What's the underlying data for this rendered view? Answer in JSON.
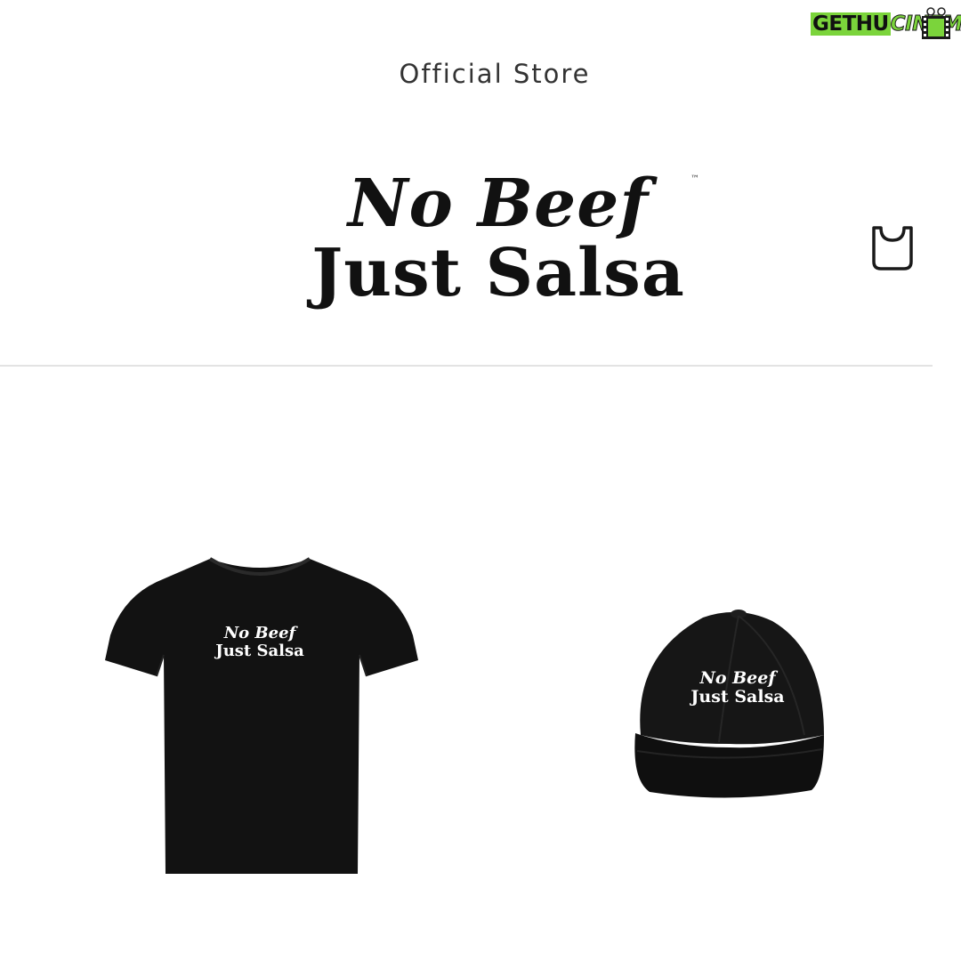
{
  "watermark": {
    "part1": "GETHU",
    "part2": "CINEMA"
  },
  "header": {
    "store_label": "Official Store",
    "logo": {
      "line1": "No Beef",
      "line2": "Just Salsa",
      "trademark": "™"
    },
    "cart_icon": "shopping-bag-icon"
  },
  "products": [
    {
      "name": "t-shirt",
      "color": "#111111",
      "print_line1": "No Beef",
      "print_line2": "Just Salsa"
    },
    {
      "name": "cap",
      "color": "#141414",
      "print_line1": "No Beef",
      "print_line2": "Just Salsa"
    }
  ],
  "colors": {
    "background": "#ffffff",
    "text": "#111111",
    "divider": "#e3e3e3",
    "watermark_green": "#7bd43b"
  }
}
